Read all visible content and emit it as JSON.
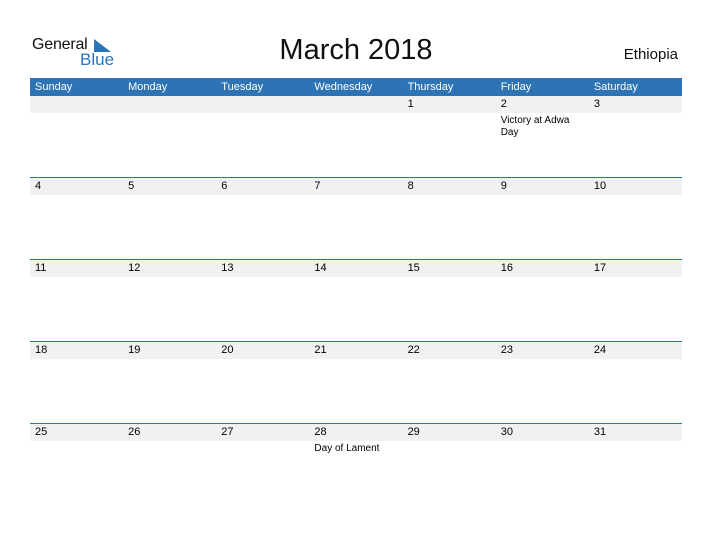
{
  "logo": {
    "general": "General",
    "blue": "Blue"
  },
  "title": "March 2018",
  "country": "Ethiopia",
  "weekdays": [
    "Sunday",
    "Monday",
    "Tuesday",
    "Wednesday",
    "Thursday",
    "Friday",
    "Saturday"
  ],
  "weeks": [
    [
      {
        "d": ""
      },
      {
        "d": ""
      },
      {
        "d": ""
      },
      {
        "d": ""
      },
      {
        "d": "1"
      },
      {
        "d": "2",
        "h": "Victory at Adwa Day"
      },
      {
        "d": "3"
      }
    ],
    [
      {
        "d": "4"
      },
      {
        "d": "5"
      },
      {
        "d": "6"
      },
      {
        "d": "7"
      },
      {
        "d": "8"
      },
      {
        "d": "9"
      },
      {
        "d": "10"
      }
    ],
    [
      {
        "d": "11"
      },
      {
        "d": "12"
      },
      {
        "d": "13"
      },
      {
        "d": "14"
      },
      {
        "d": "15"
      },
      {
        "d": "16"
      },
      {
        "d": "17"
      }
    ],
    [
      {
        "d": "18"
      },
      {
        "d": "19"
      },
      {
        "d": "20"
      },
      {
        "d": "21"
      },
      {
        "d": "22"
      },
      {
        "d": "23"
      },
      {
        "d": "24"
      }
    ],
    [
      {
        "d": "25"
      },
      {
        "d": "26"
      },
      {
        "d": "27"
      },
      {
        "d": "28",
        "h": "Day of Lament"
      },
      {
        "d": "29"
      },
      {
        "d": "30"
      },
      {
        "d": "31"
      }
    ]
  ],
  "colors": {
    "accent": "#2e73b4",
    "band": "#f1f1f1"
  }
}
